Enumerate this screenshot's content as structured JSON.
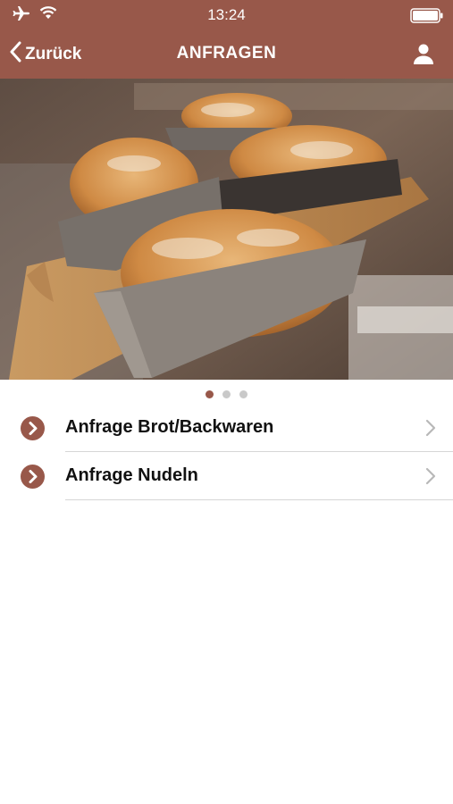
{
  "status_bar": {
    "time": "13:24"
  },
  "nav": {
    "back_label": "Zurück",
    "title": "ANFRAGEN"
  },
  "pager": {
    "pages": 3,
    "active": 1
  },
  "list": {
    "items": [
      {
        "label": "Anfrage Brot/Backwaren"
      },
      {
        "label": "Anfrage Nudeln"
      }
    ]
  },
  "colors": {
    "brand": "#98584a",
    "separator": "#d6d6d6",
    "dot_inactive": "#c9c9c9"
  },
  "icons": [
    "airplane-icon",
    "wifi-icon",
    "battery-icon",
    "back-chevron-icon",
    "profile-icon",
    "circle-chevron-right-icon",
    "chevron-right-icon"
  ]
}
